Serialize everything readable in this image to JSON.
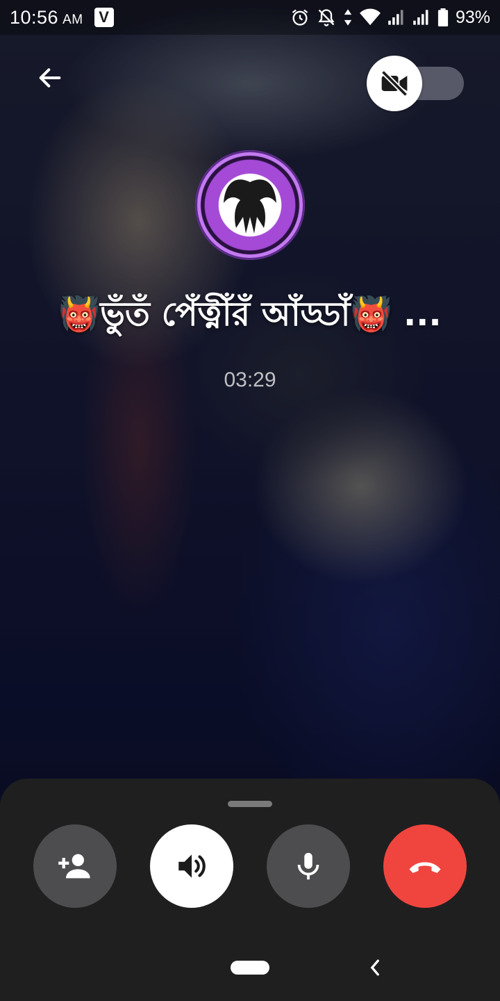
{
  "status_bar": {
    "time": "10:56",
    "ampm": "AM",
    "carrier_badge": "V",
    "battery": "93%",
    "icons": [
      "alarm-icon",
      "notifications-off-icon",
      "data-arrows-icon",
      "wifi-icon",
      "signal-icon",
      "signal-icon",
      "battery-icon"
    ]
  },
  "call": {
    "title": "👹ভুঁতঁ পেঁত্নীঁরঁ আঁড্ডাঁ👹 ...",
    "duration": "03:29",
    "video_enabled": false
  },
  "controls": {
    "buttons": [
      {
        "name": "add-person-button",
        "icon": "add-person-icon"
      },
      {
        "name": "speaker-button",
        "icon": "speaker-icon"
      },
      {
        "name": "mute-button",
        "icon": "microphone-icon"
      },
      {
        "name": "end-call-button",
        "icon": "hang-up-icon"
      }
    ]
  },
  "colors": {
    "end_call": "#f0453f",
    "sheet_bg": "#1f1f20",
    "control_bg": "#4d4d4f",
    "speaker_active": "#ffffff"
  }
}
